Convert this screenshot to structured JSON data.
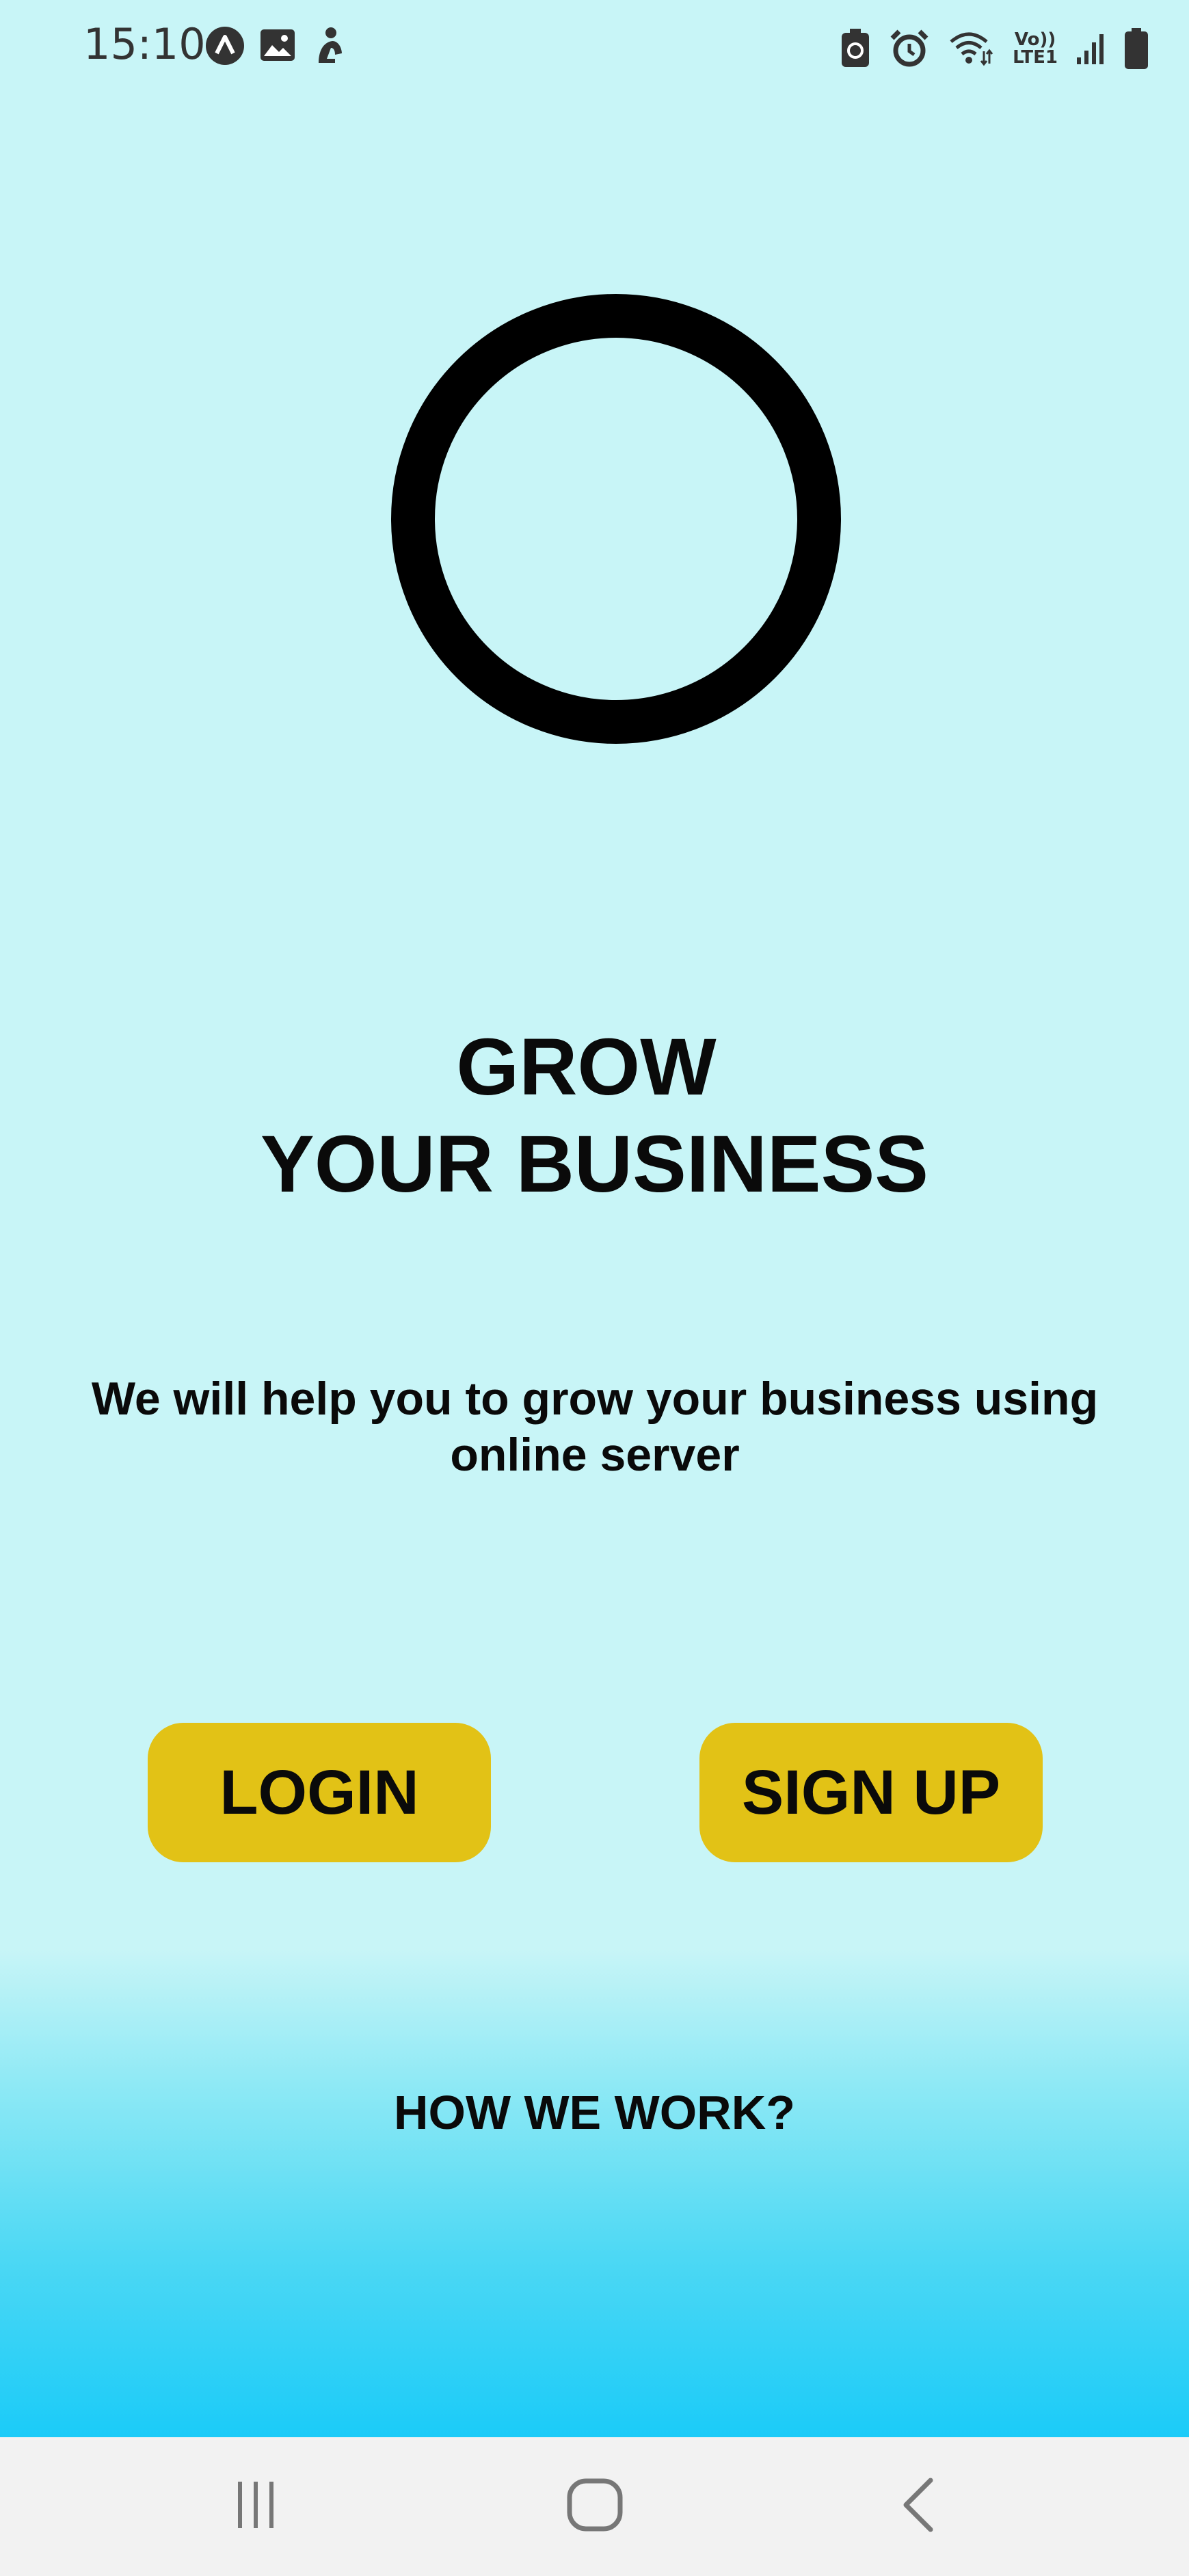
{
  "status_bar": {
    "time": "15:10",
    "left_icons": [
      "app-notification-icon",
      "gallery-icon",
      "user-activity-icon"
    ],
    "right_icons": [
      "battery-saver-icon",
      "alarm-icon",
      "wifi-icon",
      "volte-lte-icon",
      "signal-icon",
      "battery-icon"
    ],
    "volte_label": "Vo))",
    "lte_label": "LTE1"
  },
  "logo": {
    "icon": "ring-logo-icon",
    "color": "#000000"
  },
  "headline": {
    "line1": "GROW",
    "line2": "YOUR BUSINESS"
  },
  "subtitle": "We will help you to grow your business using online server",
  "buttons": {
    "login": "LOGIN",
    "signup": "SIGN UP",
    "color": "#E2C216"
  },
  "how_link": "HOW WE WORK?",
  "nav_bar": {
    "recents": "recents-icon",
    "home": "home-icon",
    "back": "back-icon"
  },
  "colors": {
    "background_top": "#C8F5F7",
    "background_bottom": "#1BCBF8"
  }
}
